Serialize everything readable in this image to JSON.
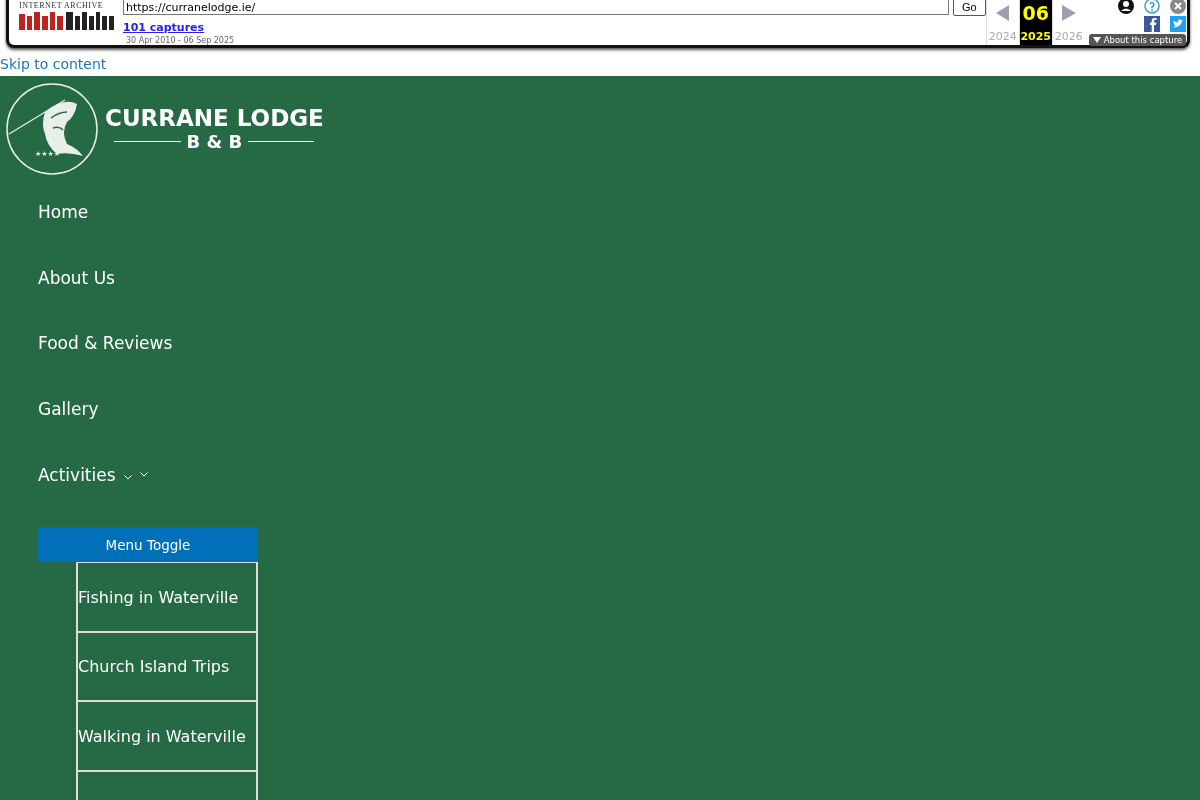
{
  "wayback": {
    "label": "INTERNET ARCHIVE",
    "url": "https://curranelodge.ie/",
    "go": "Go",
    "captures": "101 captures",
    "range": "30 Apr 2010 - 06 Sep 2025",
    "months": [
      {
        "year": "2024",
        "selected": false
      },
      {
        "day": "06",
        "year": "2025",
        "selected": true
      },
      {
        "year": "2026",
        "selected": false
      }
    ],
    "about": "About this capture"
  },
  "skip_link": "Skip to content",
  "logo": {
    "title": "CURRANE LODGE",
    "subtitle": "B & B",
    "stars": "★★★★"
  },
  "nav": [
    {
      "label": "Home",
      "has_submenu": false
    },
    {
      "label": "About Us",
      "has_submenu": false
    },
    {
      "label": "Food & Reviews",
      "has_submenu": false
    },
    {
      "label": "Gallery",
      "has_submenu": false
    },
    {
      "label": "Activities",
      "has_submenu": true
    }
  ],
  "menu_toggle": "Menu Toggle",
  "submenu": [
    "Fishing in Waterville",
    "Church Island Trips",
    "Walking in Waterville"
  ]
}
